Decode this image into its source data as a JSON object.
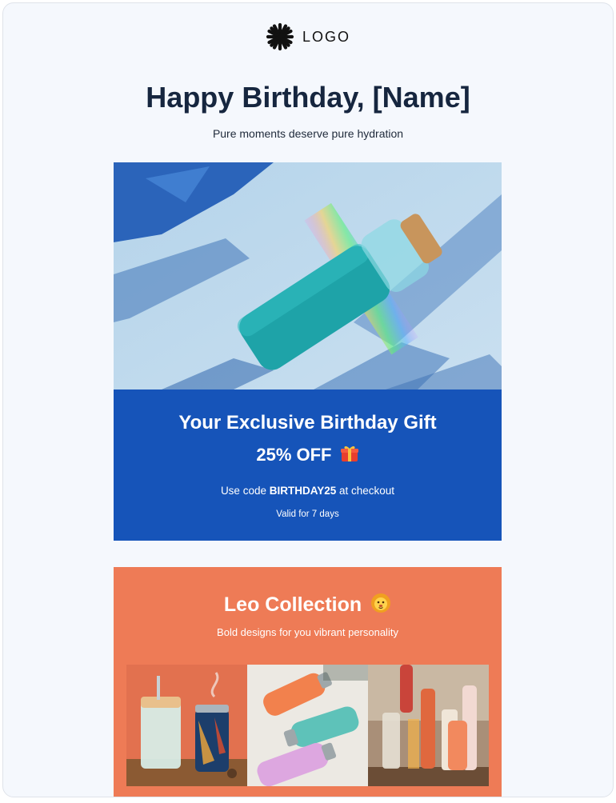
{
  "header": {
    "logo_text": "LOGO",
    "logo_icon": "asterisk-burst-icon"
  },
  "hero": {
    "title": "Happy Birthday, [Name]",
    "subtitle": "Pure moments deserve pure hydration"
  },
  "gift": {
    "title": "Your Exclusive Birthday Gift",
    "discount": "25% OFF",
    "discount_icon": "gift-emoji",
    "code_prefix": "Use code ",
    "code": "BIRTHDAY25",
    "code_suffix": " at checkout",
    "validity": "Valid for 7 days"
  },
  "collection": {
    "title": "Leo Collection",
    "title_icon": "lion-emoji",
    "subtitle": "Bold designs for you vibrant personality",
    "products": [
      "tumbler-and-travel-mug",
      "three-bottles-flatlay",
      "bottles-on-shelf"
    ]
  },
  "colors": {
    "background": "#f5f8fd",
    "heading": "#16263f",
    "gift_banner": "#1654b9",
    "collection_banner": "#ee7b56"
  }
}
